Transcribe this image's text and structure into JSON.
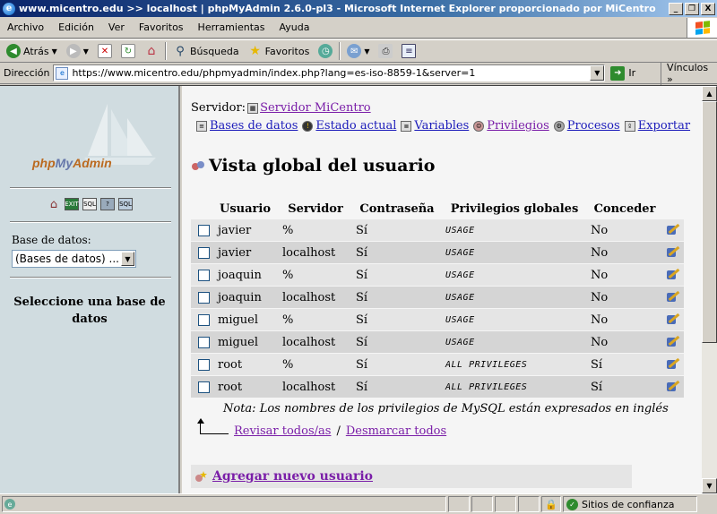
{
  "window": {
    "title": "www.micentro.edu >> localhost | phpMyAdmin 2.6.0-pl3 - Microsoft Internet Explorer proporcionado por MiCentro",
    "minimize": "_",
    "restore": "❐",
    "close": "X"
  },
  "menu": [
    "Archivo",
    "Edición",
    "Ver",
    "Favoritos",
    "Herramientas",
    "Ayuda"
  ],
  "toolbar": {
    "back": "Atrás",
    "search": "Búsqueda",
    "favorites": "Favoritos"
  },
  "address": {
    "label": "Dirección",
    "url": "https://www.micentro.edu/phpmyadmin/index.php?lang=es-iso-8859-1&server=1",
    "go": "Ir",
    "links": "Vínculos"
  },
  "left": {
    "logo_php": "php",
    "logo_my": "My",
    "logo_admin": "Admin",
    "db_label": "Base de datos:",
    "db_select": "(Bases de datos) ...",
    "select_msg": "Seleccione una base de datos"
  },
  "main": {
    "server_label": "Servidor:",
    "server_name": "Servidor MiCentro",
    "tabs": [
      "Bases de datos",
      "Estado actual",
      "Variables",
      "Privilegios",
      "Procesos",
      "Exportar"
    ],
    "title": "Vista global del usuario",
    "columns": [
      "Usuario",
      "Servidor",
      "Contraseña",
      "Privilegios globales",
      "Conceder"
    ],
    "rows": [
      {
        "user": "javier",
        "host": "%",
        "pwd": "Sí",
        "priv": "USAGE",
        "grant": "No"
      },
      {
        "user": "javier",
        "host": "localhost",
        "pwd": "Sí",
        "priv": "USAGE",
        "grant": "No"
      },
      {
        "user": "joaquin",
        "host": "%",
        "pwd": "Sí",
        "priv": "USAGE",
        "grant": "No"
      },
      {
        "user": "joaquin",
        "host": "localhost",
        "pwd": "Sí",
        "priv": "USAGE",
        "grant": "No"
      },
      {
        "user": "miguel",
        "host": "%",
        "pwd": "Sí",
        "priv": "USAGE",
        "grant": "No"
      },
      {
        "user": "miguel",
        "host": "localhost",
        "pwd": "Sí",
        "priv": "USAGE",
        "grant": "No"
      },
      {
        "user": "root",
        "host": "%",
        "pwd": "Sí",
        "priv": "ALL PRIVILEGES",
        "grant": "Sí"
      },
      {
        "user": "root",
        "host": "localhost",
        "pwd": "Sí",
        "priv": "ALL PRIVILEGES",
        "grant": "Sí"
      }
    ],
    "note": "Nota: Los nombres de los privilegios de MySQL están expresados en inglés",
    "check_all": "Revisar todos/as",
    "separator": "/",
    "uncheck_all": "Desmarcar todos",
    "add_user": "Agregar nuevo usuario"
  },
  "status": {
    "zone": "Sitios de confianza"
  },
  "colors": {
    "title_bar": "#0a246a",
    "visited_link": "#7a1ea8",
    "link": "#1b1bba",
    "left_frame": "#d0dce0"
  }
}
